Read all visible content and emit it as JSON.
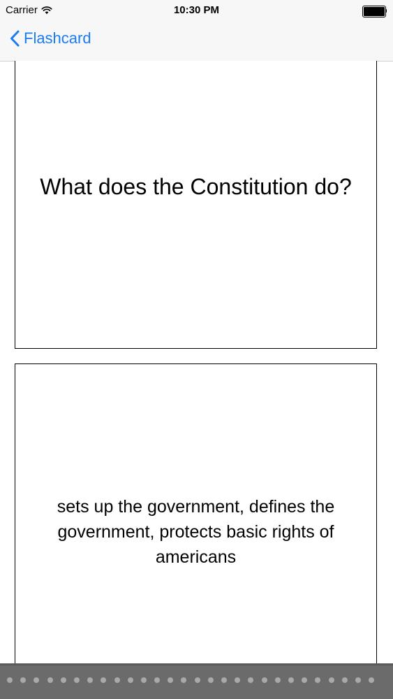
{
  "status_bar": {
    "carrier": "Carrier",
    "time": "10:30 PM",
    "battery_level": 1.0
  },
  "nav": {
    "back_label": "Flashcard"
  },
  "card": {
    "question": "What does the Constitution do?",
    "answer": "sets up the government, defines the government, protects basic rights of americans"
  },
  "icons": {
    "wifi": "wifi-icon",
    "battery": "battery-icon",
    "back": "chevron-left-icon"
  },
  "colors": {
    "accent": "#1a7cf0",
    "scrubber": "#6b6b6b"
  }
}
